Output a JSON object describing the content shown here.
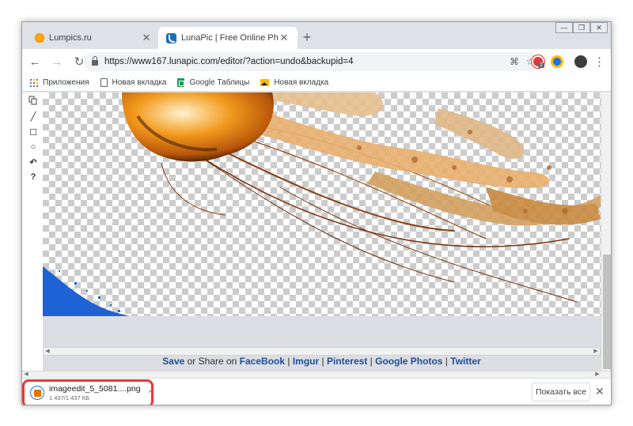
{
  "tabs": [
    {
      "title": "Lumpics.ru",
      "active": false
    },
    {
      "title": "LunaPic | Free Online Photo Edito",
      "active": true
    }
  ],
  "window_controls": {
    "minimize": "—",
    "restore": "❐",
    "close": "✕"
  },
  "toolbar": {
    "url": "https://www167.lunapic.com/editor/?action=undo&backupid=4",
    "back": "←",
    "forward": "→",
    "reload": "↻",
    "menu": "⋮",
    "translate": "⌘",
    "star": "☆",
    "extension_badge": "2"
  },
  "bookmarks": [
    {
      "label": "Приложения",
      "icon": "apps-grid-icon"
    },
    {
      "label": "Новая вкладка",
      "icon": "page-icon"
    },
    {
      "label": "Google Таблицы",
      "icon": "sheets-icon"
    },
    {
      "label": "Новая вкладка",
      "icon": "image-icon"
    }
  ],
  "editor_tools": [
    "copy-icon",
    "line-icon",
    "rectangle-icon",
    "circle-icon",
    "undo-icon",
    "help-icon"
  ],
  "tool_glyphs": {
    "line": "╱",
    "rect": "☐",
    "circle": "○",
    "undo": "↶",
    "help": "?"
  },
  "share": {
    "save": "Save",
    "or_share_on": " or Share on ",
    "links": [
      "FaceBook",
      "Imgur",
      "Pinterest",
      "Google Photos",
      "Twitter"
    ],
    "sep": " | "
  },
  "download": {
    "filename": "imageedit_5_5081....png",
    "size": "1 437/1 437 КБ",
    "menu": "^",
    "show_all": "Показать все",
    "close": "✕"
  },
  "colors": {
    "highlight": "#e53935",
    "link": "#1f4e9a",
    "jellyfish": "#e07a10"
  }
}
